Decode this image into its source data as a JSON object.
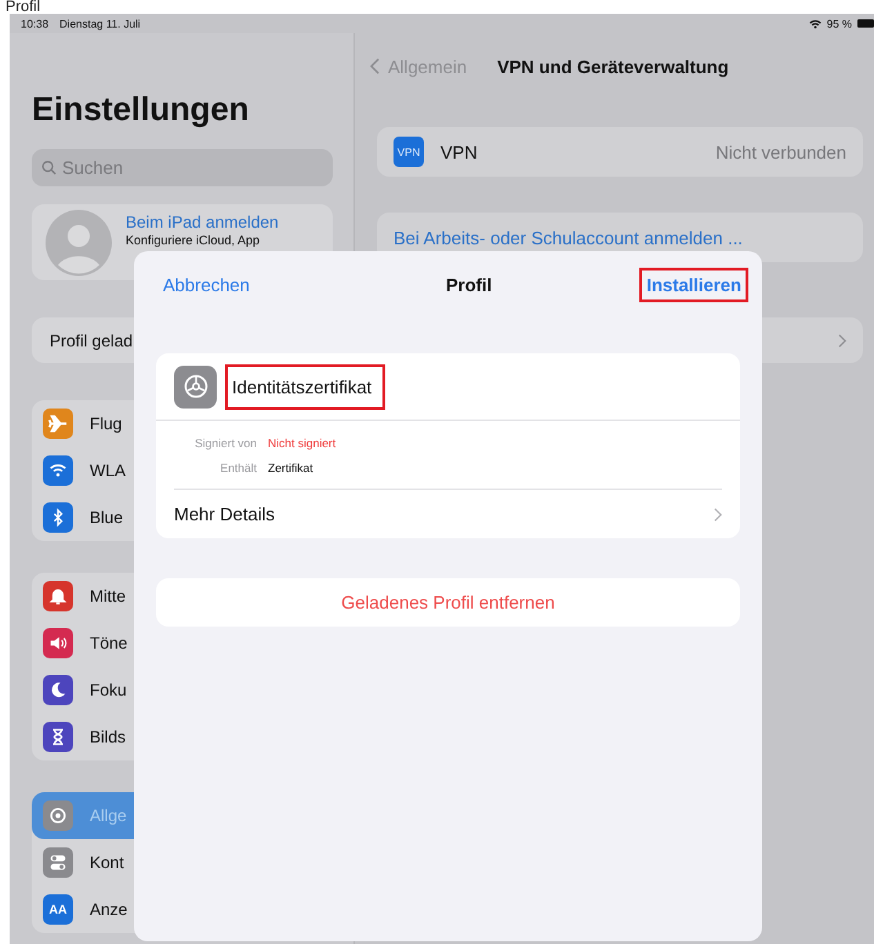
{
  "page_heading": "Profil",
  "status_bar": {
    "time": "10:38",
    "date": "Dienstag 11. Juli",
    "battery": "95 %"
  },
  "sidebar": {
    "title": "Einstellungen",
    "search": {
      "placeholder": "Suchen"
    },
    "account": {
      "title": "Beim iPad anmelden",
      "subtitle": "Konfiguriere iCloud, App"
    },
    "notice": "Profil gelad",
    "groups": [
      [
        {
          "label": "Flug",
          "kind": "airplane",
          "color": "#e0861c",
          "selected": false
        },
        {
          "label": "WLA",
          "kind": "wifi",
          "color": "#1b6fd8",
          "selected": false
        },
        {
          "label": "Blue",
          "kind": "bluetooth",
          "color": "#1b6fd8",
          "selected": false
        }
      ],
      [
        {
          "label": "Mitte",
          "kind": "bell",
          "color": "#d6352c",
          "selected": false
        },
        {
          "label": "Töne",
          "kind": "speaker",
          "color": "#d42a50",
          "selected": false
        },
        {
          "label": "Foku",
          "kind": "moon",
          "color": "#4d45bd",
          "selected": false
        },
        {
          "label": "Bilds",
          "kind": "hourglass",
          "color": "#4d45bd",
          "selected": false
        }
      ],
      [
        {
          "label": "Allge",
          "kind": "gear",
          "color": "#8a8a8e",
          "selected": true
        },
        {
          "label": "Kont",
          "kind": "toggles",
          "color": "#8a8a8e",
          "selected": false
        },
        {
          "label": "Anze",
          "kind": "text",
          "glyph": "AA",
          "color": "#1b6fd8",
          "selected": false
        }
      ]
    ]
  },
  "detail": {
    "back": "Allgemein",
    "title": "VPN und Geräteverwaltung",
    "vpn": {
      "icon_text": "VPN",
      "label": "VPN",
      "value": "Nicht verbunden"
    },
    "work_account": "Bei Arbeits- oder Schulaccount anmelden ..."
  },
  "modal": {
    "cancel": "Abbrechen",
    "title": "Profil",
    "install": {
      "label": "Installieren",
      "highlighted": true
    },
    "profile": {
      "name": "Identitätszertifikat",
      "highlighted": true,
      "fields": [
        {
          "label": "Signiert von",
          "value": "Nicht signiert",
          "warning": true
        },
        {
          "label": "Enthält",
          "value": "Zertifikat",
          "warning": false
        }
      ],
      "more": "Mehr Details"
    },
    "remove": "Geladenes Profil entfernen"
  }
}
